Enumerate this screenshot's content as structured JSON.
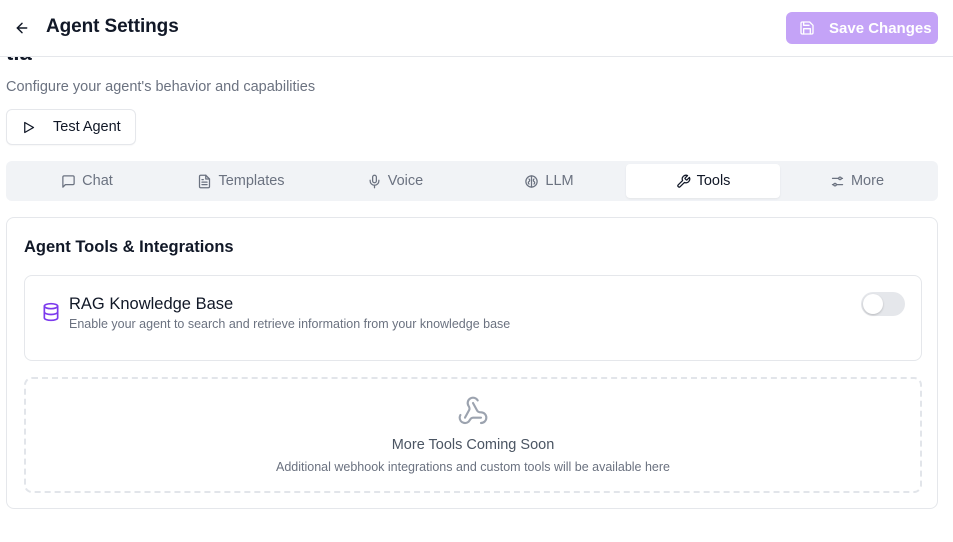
{
  "header": {
    "title": "Agent Settings",
    "back_icon": "arrow-left-icon",
    "save_label": "Save Changes",
    "save_icon": "save-icon",
    "save_color": "#c4a3f7"
  },
  "agent": {
    "name_fragment": "tia",
    "subtitle": "Configure your agent's behavior and capabilities",
    "test_button_label": "Test Agent",
    "test_button_icon": "play-icon"
  },
  "tabs": [
    {
      "label": "Chat",
      "icon": "message-square-icon",
      "active": false
    },
    {
      "label": "Templates",
      "icon": "file-text-icon",
      "active": false
    },
    {
      "label": "Voice",
      "icon": "mic-icon",
      "active": false
    },
    {
      "label": "LLM",
      "icon": "brain-icon",
      "active": false
    },
    {
      "label": "Tools",
      "icon": "wrench-icon",
      "active": true
    },
    {
      "label": "More",
      "icon": "sliders-icon",
      "active": false
    }
  ],
  "tools_card": {
    "title": "Agent Tools & Integrations",
    "rag": {
      "name": "RAG Knowledge Base",
      "description": "Enable your agent to search and retrieve information from your knowledge base",
      "icon": "database-icon",
      "icon_color": "#7c3aed",
      "enabled": false
    },
    "coming_soon": {
      "title": "More Tools Coming Soon",
      "description": "Additional webhook integrations and custom tools will be available here",
      "icon": "webhook-icon"
    }
  }
}
